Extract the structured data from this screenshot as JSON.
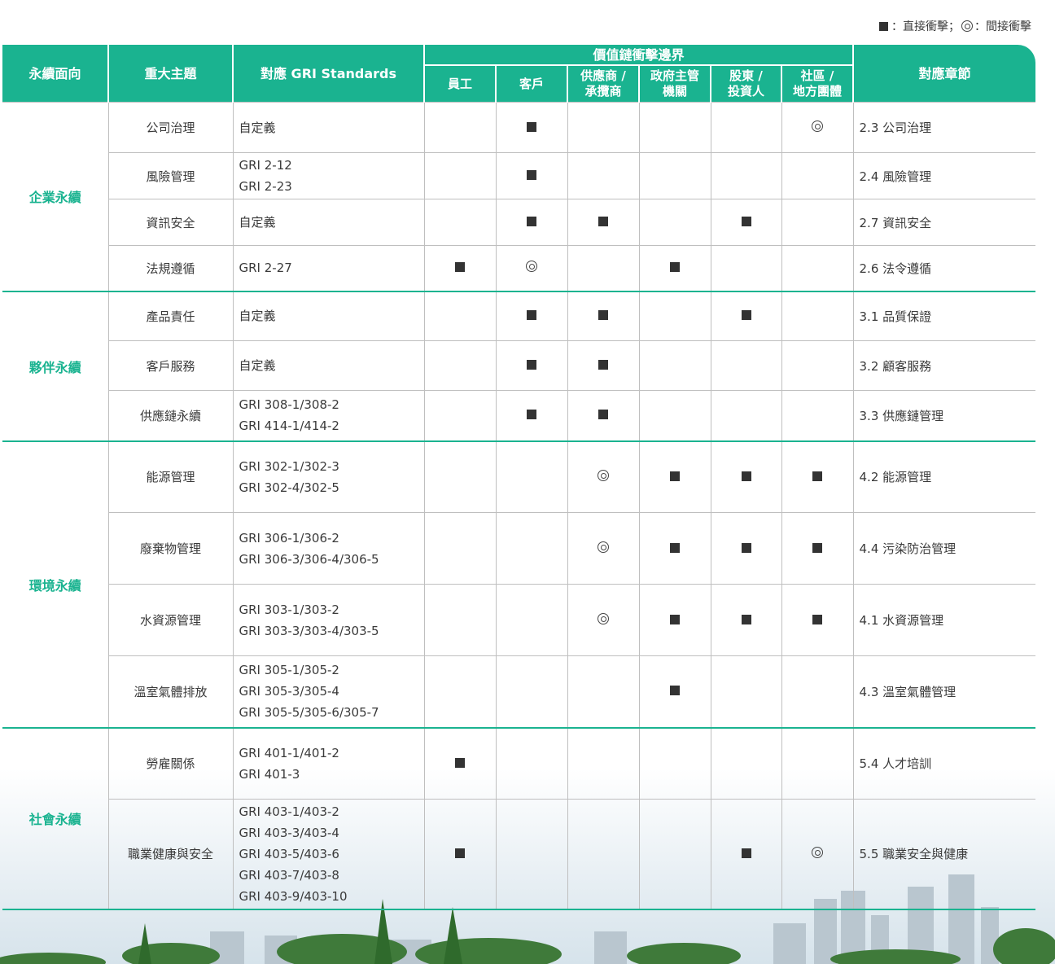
{
  "legend": {
    "direct_label": "：直接衝擊；",
    "indirect_label": "：間接衝擊"
  },
  "headers": {
    "aspect": "永續面向",
    "topic": "重大主題",
    "gri": "對應 GRI Standards",
    "value_chain": "價值鏈衝擊邊界",
    "chapter": "對應章節",
    "stakeholders": [
      [
        "員工"
      ],
      [
        "客戶"
      ],
      [
        "供應商 /",
        "承攬商"
      ],
      [
        "政府主管",
        "機關"
      ],
      [
        "股東 /",
        "投資人"
      ],
      [
        "社區 /",
        "地方團體"
      ]
    ]
  },
  "groups": [
    {
      "aspect": "企業永續",
      "rows": [
        {
          "topic": "公司治理",
          "gri": [
            "自定義"
          ],
          "marks": [
            "",
            "direct",
            "",
            "",
            "",
            "indirect"
          ],
          "chapter": "2.3 公司治理"
        },
        {
          "topic": "風險管理",
          "gri": [
            "GRI 2-12",
            "GRI 2-23"
          ],
          "marks": [
            "",
            "direct",
            "",
            "",
            "",
            ""
          ],
          "chapter": "2.4 風險管理"
        },
        {
          "topic": "資訊安全",
          "gri": [
            "自定義"
          ],
          "marks": [
            "",
            "direct",
            "direct",
            "",
            "direct",
            ""
          ],
          "chapter": "2.7 資訊安全"
        },
        {
          "topic": "法規遵循",
          "gri": [
            "GRI 2-27"
          ],
          "marks": [
            "direct",
            "indirect",
            "",
            "direct",
            "",
            ""
          ],
          "chapter": "2.6 法令遵循"
        }
      ]
    },
    {
      "aspect": "夥伴永續",
      "rows": [
        {
          "topic": "產品責任",
          "gri": [
            "自定義"
          ],
          "marks": [
            "",
            "direct",
            "direct",
            "",
            "direct",
            ""
          ],
          "chapter": "3.1 品質保證"
        },
        {
          "topic": "客戶服務",
          "gri": [
            "自定義"
          ],
          "marks": [
            "",
            "direct",
            "direct",
            "",
            "",
            ""
          ],
          "chapter": "3.2 顧客服務"
        },
        {
          "topic": "供應鏈永續",
          "gri": [
            "GRI 308-1/308-2",
            "GRI 414-1/414-2"
          ],
          "marks": [
            "",
            "direct",
            "direct",
            "",
            "",
            ""
          ],
          "chapter": "3.3 供應鏈管理"
        }
      ]
    },
    {
      "aspect": "環境永續",
      "rows": [
        {
          "topic": "能源管理",
          "gri": [
            "GRI 302-1/302-3",
            "GRI 302-4/302-5"
          ],
          "marks": [
            "",
            "",
            "indirect",
            "direct",
            "direct",
            "direct"
          ],
          "chapter": "4.2 能源管理"
        },
        {
          "topic": "廢棄物管理",
          "gri": [
            "GRI 306-1/306-2",
            "GRI 306-3/306-4/306-5"
          ],
          "marks": [
            "",
            "",
            "indirect",
            "direct",
            "direct",
            "direct"
          ],
          "chapter": "4.4 污染防治管理"
        },
        {
          "topic": "水資源管理",
          "gri": [
            "GRI 303-1/303-2",
            "GRI 303-3/303-4/303-5"
          ],
          "marks": [
            "",
            "",
            "indirect",
            "direct",
            "direct",
            "direct"
          ],
          "chapter": "4.1 水資源管理"
        },
        {
          "topic": "溫室氣體排放",
          "gri": [
            "GRI 305-1/305-2",
            "GRI 305-3/305-4",
            "GRI 305-5/305-6/305-7"
          ],
          "marks": [
            "",
            "",
            "",
            "direct",
            "",
            ""
          ],
          "chapter": "4.3 溫室氣體管理"
        }
      ]
    },
    {
      "aspect": "社會永續",
      "rows": [
        {
          "topic": "勞雇關係",
          "gri": [
            "GRI 401-1/401-2",
            "GRI 401-3"
          ],
          "marks": [
            "direct",
            "",
            "",
            "",
            "",
            ""
          ],
          "chapter": "5.4 人才培訓"
        },
        {
          "topic": "職業健康與安全",
          "gri": [
            "GRI 403-1/403-2",
            "GRI 403-3/403-4",
            "GRI 403-5/403-6",
            "GRI 403-7/403-8",
            "GRI 403-9/403-10"
          ],
          "marks": [
            "direct",
            "",
            "",
            "",
            "direct",
            "indirect"
          ],
          "chapter": "5.5 職業安全與健康"
        }
      ]
    }
  ]
}
